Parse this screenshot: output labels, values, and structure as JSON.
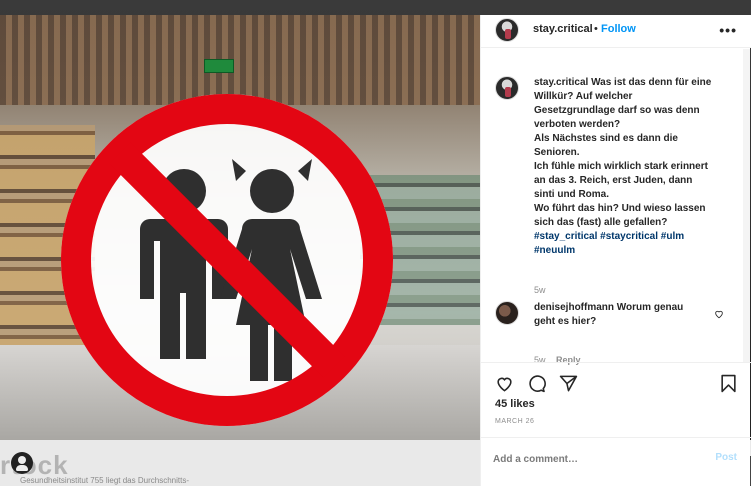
{
  "background": {
    "wordmark": "rtock",
    "faint_caption": "Gesundheitsinstitut 755 liegt das Durchschnitts-"
  },
  "post": {
    "username": "stay.critical",
    "separator": "•",
    "follow_label": "Follow",
    "more_label": "•••",
    "caption_lines": [
      "Was ist das denn für eine",
      "Willkür? Auf welcher",
      "Gesetzgrundlage darf so was denn",
      "verboten werden?",
      "Als Nächstes sind es dann die",
      "Senioren.",
      "Ich fühle mich wirklich stark erinnert",
      "an das 3. Reich, erst Juden, dann",
      "sinti und Roma.",
      "Wo führt das hin? Und wieso lassen",
      "sich das (fast) alle gefallen?"
    ],
    "hashtags": [
      "#stay_critical",
      "#staycritical",
      "#ulm",
      "#neuulm"
    ],
    "caption_time": "5w",
    "comments": [
      {
        "username": "denisejhoffmann",
        "text_line1": "Worum genau",
        "text_line2": "geht es hier?",
        "time": "5w",
        "reply_label": "Reply"
      }
    ],
    "likes": "45 likes",
    "date": "MARCH 26",
    "add_comment_placeholder": "Add a comment…",
    "post_label": "Post"
  },
  "colors": {
    "accent": "#0095f6",
    "hashtag": "#00376b",
    "sign_red": "#e30613",
    "post_disabled": "#b2dffc"
  },
  "icons": [
    "heart-icon",
    "comment-icon",
    "share-icon",
    "bookmark-icon",
    "small-heart-icon"
  ]
}
